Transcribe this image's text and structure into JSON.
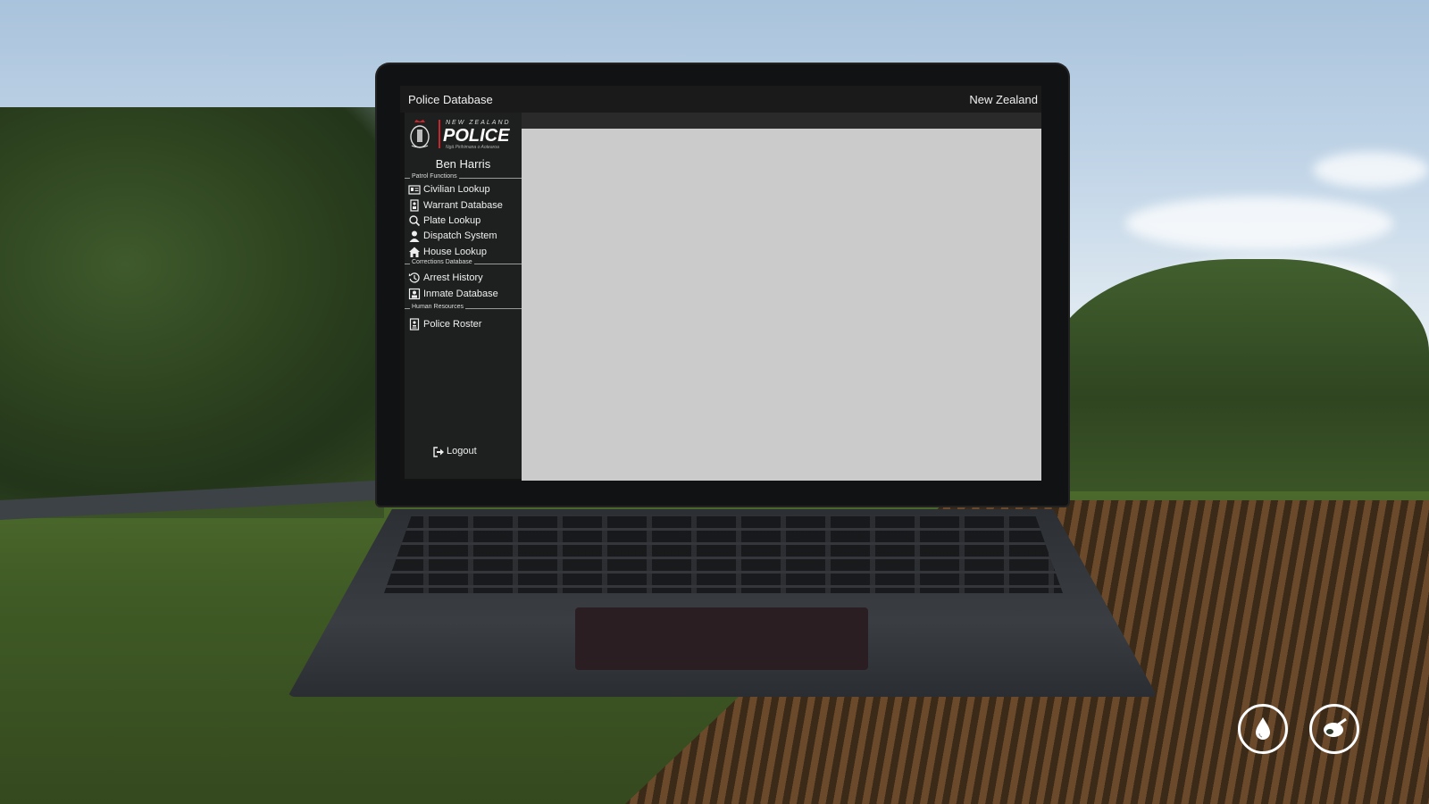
{
  "window": {
    "title": "Police Database",
    "region": "New Zealand"
  },
  "logo": {
    "country": "NEW ZEALAND",
    "name": "POLICE",
    "maori": "Ngā Pirihimana o Aotearoa"
  },
  "user": {
    "name": "Ben Harris"
  },
  "sidebar": {
    "sections": [
      {
        "label": "Patrol Functions"
      },
      {
        "label": "Corrections Database"
      },
      {
        "label": "Human Resources"
      }
    ],
    "items": [
      {
        "label": "Civilian Lookup",
        "icon": "id-card-icon"
      },
      {
        "label": "Warrant Database",
        "icon": "document-icon"
      },
      {
        "label": "Plate Lookup",
        "icon": "search-icon"
      },
      {
        "label": "Dispatch System",
        "icon": "user-icon"
      },
      {
        "label": "House Lookup",
        "icon": "house-icon"
      },
      {
        "label": "Arrest History",
        "icon": "history-icon"
      },
      {
        "label": "Inmate Database",
        "icon": "inmate-icon"
      },
      {
        "label": "Police Roster",
        "icon": "roster-icon"
      }
    ],
    "logout_label": "Logout"
  },
  "hud": {
    "buttons": [
      {
        "icon": "water-drop-icon"
      },
      {
        "icon": "food-icon"
      }
    ]
  },
  "colors": {
    "titlebar": "#1a1a1a",
    "sidebar": "#1e1f1f",
    "content": "#cbcbcb",
    "logo_accent": "#c8252c"
  }
}
